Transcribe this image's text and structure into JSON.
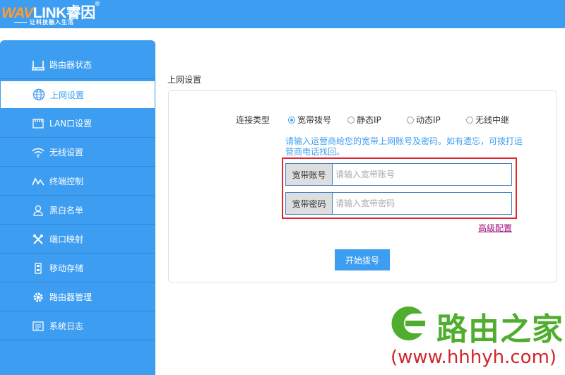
{
  "brand": {
    "logo_prefix": "WAV",
    "logo_main": "LINK睿因",
    "registered": "®",
    "slogan": "让科技融入生活"
  },
  "sidebar": {
    "items": [
      {
        "label": "路由器状态",
        "icon": "router-status-icon"
      },
      {
        "label": "上网设置",
        "icon": "globe-icon",
        "active": true
      },
      {
        "label": "LAN口设置",
        "icon": "lan-port-icon"
      },
      {
        "label": "无线设置",
        "icon": "wifi-icon"
      },
      {
        "label": "终端控制",
        "icon": "terminal-control-icon"
      },
      {
        "label": "黑白名单",
        "icon": "user-list-icon"
      },
      {
        "label": "端口映射",
        "icon": "tools-icon"
      },
      {
        "label": "移动存储",
        "icon": "usb-storage-icon"
      },
      {
        "label": "路由器管理",
        "icon": "gear-icon"
      },
      {
        "label": "系统日志",
        "icon": "log-icon"
      }
    ]
  },
  "main": {
    "section_title": "上网设置",
    "connection_type_label": "连接类型",
    "connection_types": [
      {
        "label": "宽带拨号",
        "checked": true
      },
      {
        "label": "静态IP",
        "checked": false
      },
      {
        "label": "动态IP",
        "checked": false
      },
      {
        "label": "无线中继",
        "checked": false
      }
    ],
    "hint": "请输入运营商给您的宽带上网账号及密码。如有遗忘，可拨打运营商电话找回。",
    "account": {
      "label": "宽带账号",
      "placeholder": "请输入宽带账号",
      "value": ""
    },
    "password": {
      "label": "宽带密码",
      "placeholder": "请输入宽带密码",
      "value": ""
    },
    "advanced_link": "高级配置",
    "start_button": "开始拨号"
  },
  "watermark": {
    "site_name": "路由之家",
    "url": "(www.hhhyh.com)"
  },
  "colors": {
    "primary": "#3d9df1",
    "highlight_box": "#e0262b",
    "link": "#a0127c",
    "watermark_green": "#4fae2e",
    "watermark_red": "#d0262e"
  }
}
